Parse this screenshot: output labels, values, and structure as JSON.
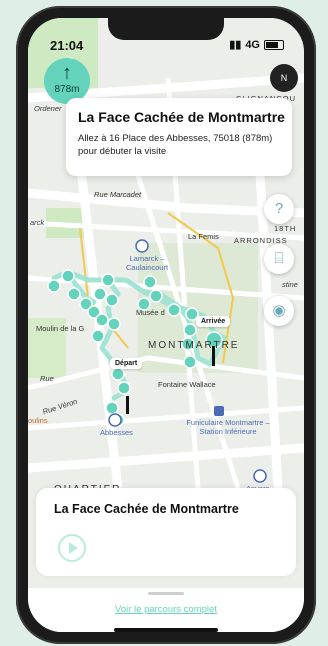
{
  "status": {
    "time": "21:04",
    "network": "4G"
  },
  "distance": {
    "value": "878m"
  },
  "compass": {
    "label": "N"
  },
  "info_card": {
    "title": "La Face Cachée de Montmartre",
    "text": "Allez à 16 Place des Abbesses, 75018 (878m) pour débuter la visite"
  },
  "map_labels": {
    "l1": "Ordener",
    "l2": "CLIGNANCOU",
    "l3": "Rue Marcadet",
    "l4": "La Femis",
    "l5": "18TH",
    "l6": "ARRONDISS",
    "l7": "Lamarck – Caulaincourt",
    "l8": "Musée d",
    "l9": "Moulin de la G",
    "l10": "MONTMARTRE",
    "l11": "Fontaine Wallace",
    "l12": "Rue Véron",
    "l13": "oulins",
    "l14": "Abbesses",
    "l15": "Funiculaire Montmartre – Station Inférieure",
    "l16": "Anvers",
    "l17": "QUARTIER",
    "l18": "arck",
    "l19": "Rue",
    "l20": "stine"
  },
  "markers": {
    "start": "Départ",
    "end": "Arrivée"
  },
  "bottom": {
    "title": "La Face Cachée de Montmartre",
    "link": "Voir le parcours complet"
  },
  "colors": {
    "accent": "#63d4bb",
    "route": "#9fe3d2"
  }
}
